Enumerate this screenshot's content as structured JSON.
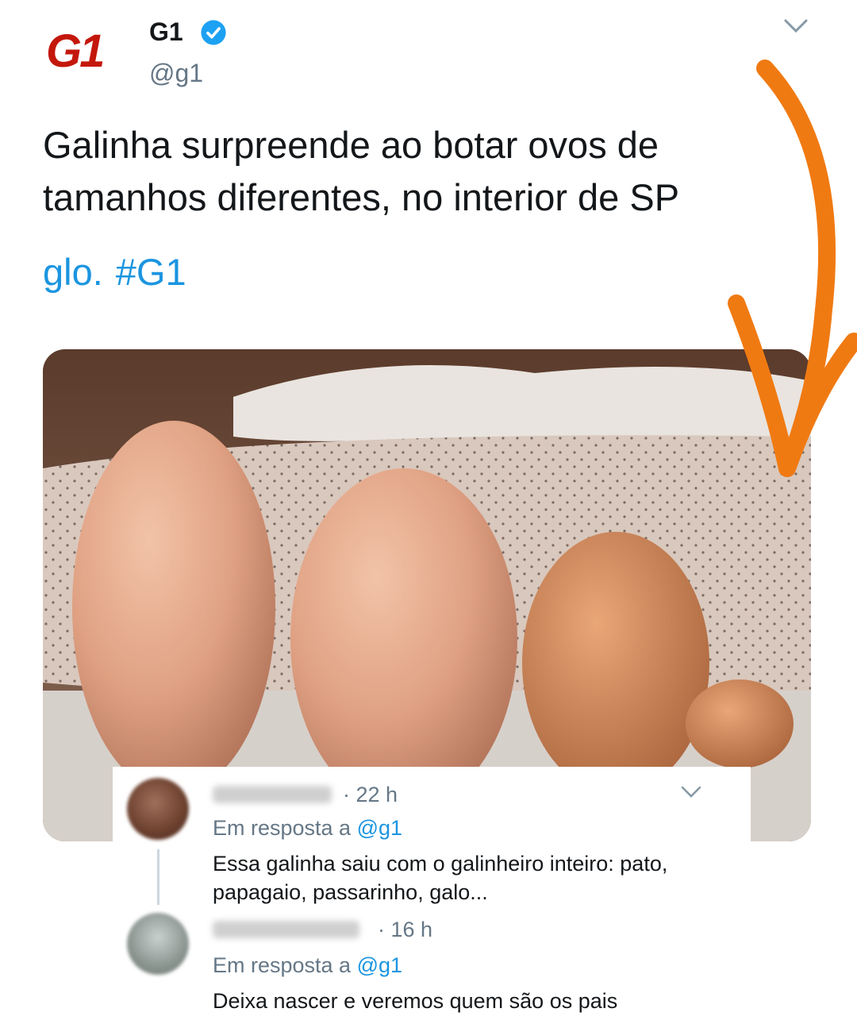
{
  "tweet": {
    "logo_text": "G1",
    "name": "G1",
    "handle": "@g1",
    "text": "Galinha surpreende ao botar ovos de tamanhos diferentes, no interior de SP",
    "link_text": "glo.",
    "hashtag": "#G1",
    "link_color": "#1b95e0",
    "brand_color": "#c4170c"
  },
  "replies": [
    {
      "time": "· 22 h",
      "reply_prefix": "Em resposta a",
      "reply_to": "@g1",
      "body": "Essa galinha saiu com o galinheiro inteiro: pato, papagaio, passarinho, galo..."
    },
    {
      "time": "· 16 h",
      "reply_prefix": "Em resposta a",
      "reply_to": "@g1",
      "body": "Deixa nascer e veremos quem são os pais"
    }
  ],
  "icons": {
    "verified": "verified-badge-icon",
    "menu": "chevron-down-icon",
    "annotation": "orange-arrow-icon"
  },
  "photo": {
    "egg_count": 4
  }
}
